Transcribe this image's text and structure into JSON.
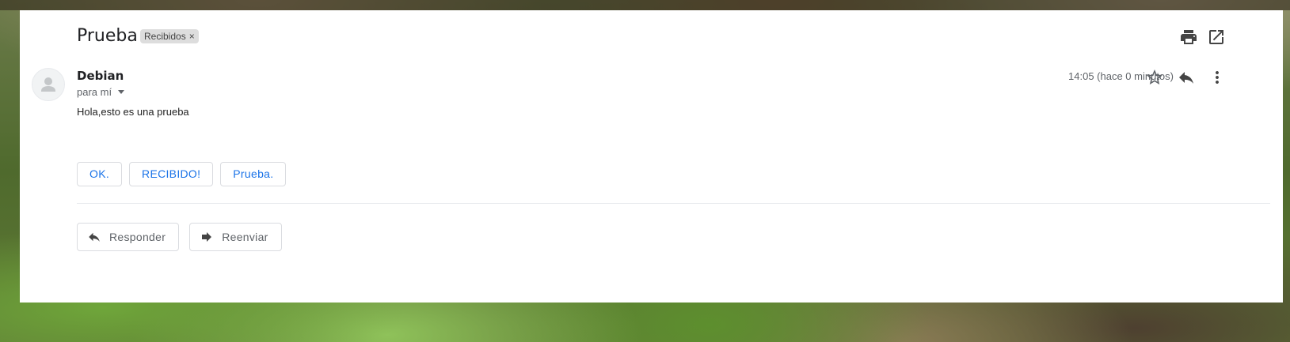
{
  "email": {
    "subject": "Prueba",
    "label": "Recibidos",
    "label_remove": "×",
    "sender": "Debian",
    "recipient": "para mí",
    "time": "14:05 (hace 0 minutos)",
    "body": "Hola,esto es una prueba"
  },
  "smart_replies": [
    "OK.",
    "RECIBIDO!",
    "Prueba."
  ],
  "actions": {
    "reply_label": "Responder",
    "forward_label": "Reenviar"
  },
  "icons": {
    "print": "print-icon",
    "open_new_window": "open-in-new-window-icon",
    "star": "star-icon",
    "reply": "reply-icon",
    "more": "more-vert-icon",
    "avatar": "person-icon",
    "forward": "forward-icon"
  },
  "colors": {
    "accent": "#1a73e8",
    "icon": "#5f6368",
    "text": "#202124"
  }
}
